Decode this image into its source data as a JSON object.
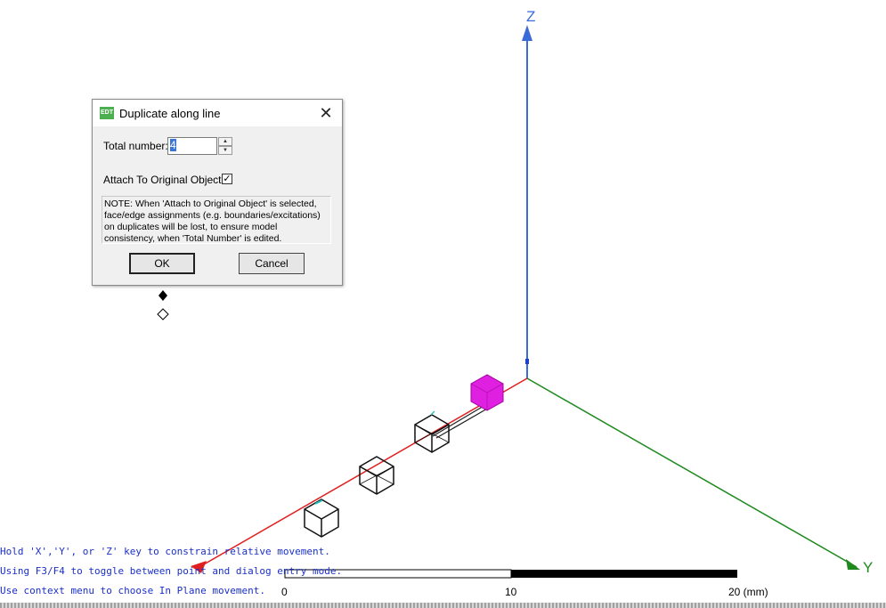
{
  "dialog": {
    "title": "Duplicate along line",
    "app_icon_text": "EDT",
    "close_symbol": "✕",
    "total_number_label": "Total number:",
    "total_number_value": "4",
    "attach_label": "Attach To Original Object:",
    "attach_checked": true,
    "attach_check_mark": "✓",
    "note": "NOTE:  When 'Attach to Original Object' is selected,\nface/edge assignments (e.g. boundaries/excitations)\non duplicates will be lost, to ensure model\nconsistency, when 'Total Number' is edited.",
    "ok_label": "OK",
    "cancel_label": "Cancel"
  },
  "axes": {
    "z_label": "Z",
    "y_label": "Y",
    "colors": {
      "z": "#3a6bd8",
      "y": "#1e8a1e",
      "x": "#e02020"
    }
  },
  "highlight_color": "#e020e0",
  "hints": [
    "Hold 'X','Y', or 'Z' key to constrain relative movement.",
    "Using F3/F4 to toggle between point and dialog entry mode.",
    "Use context menu to choose In Plane movement."
  ],
  "scale": {
    "label_0": "0",
    "label_10": "10",
    "label_20": "20 (mm)"
  },
  "icons": [
    "app-icon",
    "close-icon",
    "spin-up-icon",
    "spin-down-icon",
    "checkmark-icon",
    "snap-diamond-filled-icon",
    "snap-diamond-outline-icon"
  ]
}
